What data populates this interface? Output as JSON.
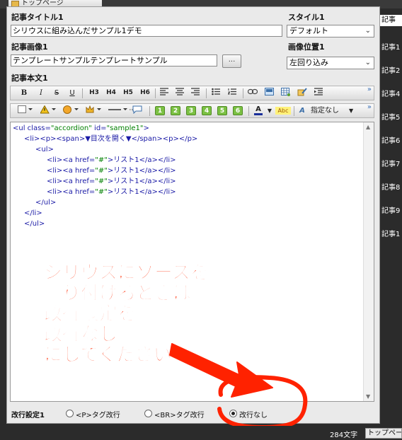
{
  "top_tab": {
    "label": "トップページ"
  },
  "form": {
    "title_label": "記事タイトル1",
    "title_value": "シリウスに組み込んだサンプル1デモ",
    "style_label": "スタイル1",
    "style_value": "デフォルト",
    "image_label": "記事画像1",
    "image_value": "テンプレートサンプルテンプレートサンプル",
    "browse_label": "...",
    "image_pos_label": "画像位置1",
    "image_pos_value": "左回り込み",
    "body_label": "記事本文1"
  },
  "toolbar1": {
    "bold": "B",
    "italic": "I",
    "strike": "S",
    "underline": "U",
    "h3": "H3",
    "h4": "H4",
    "h5": "H5",
    "h6": "H6",
    "more": "»"
  },
  "toolbar2": {
    "n1": "1",
    "n2": "2",
    "n3": "3",
    "n4": "4",
    "n5": "5",
    "n6": "6",
    "font_color": "A",
    "bg_color": "Abc",
    "style_icon": "A",
    "style_value": "指定なし",
    "more": "»"
  },
  "code": {
    "l1a": "<ul class=",
    "l1b": "\"accordion\"",
    "l1c": " id=",
    "l1d": "\"sample1\"",
    "l1e": ">",
    "l2": "<li><p><span>▼目次を開く▼</span><p></p>",
    "l3": "<ul>",
    "l4a": "<li><a href=",
    "l4b": "\"#\"",
    "l4c": ">リスト1</a></li>",
    "l5a": "<li><a href=",
    "l5b": "\"#\"",
    "l5c": ">リスト1</a></li>",
    "l6a": "<li><a href=",
    "l6b": "\"#\"",
    "l6c": ">リスト1</a></li>",
    "l7a": "<li><a href=",
    "l7b": "\"#\"",
    "l7c": ">リスト1</a></li>",
    "l8": "</ul>",
    "l9": "</li>",
    "l10": "</ul>"
  },
  "annotation": {
    "line1": "シリウスにソースを",
    "line2": "貼り付けるときは",
    "line3": "改行設定を",
    "line4": "改行なし",
    "line5": "にしてください",
    "color": "#ff2a00"
  },
  "linebreak": {
    "label": "改行設定1",
    "opt_p": "<P>タグ改行",
    "opt_br": "<BR>タグ改行",
    "opt_none": "改行なし"
  },
  "right_list": [
    "記事",
    "記事1",
    "記事2",
    "記事4",
    "記事5",
    "記事6",
    "記事7",
    "記事8",
    "記事9",
    "記事1"
  ],
  "status": {
    "char_count": "284文字",
    "page_tab": "トップページ"
  }
}
